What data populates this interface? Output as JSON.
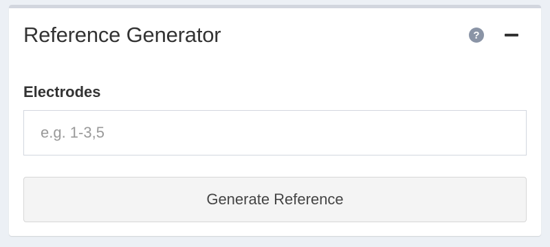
{
  "panel": {
    "title": "Reference Generator",
    "help_icon": "question-circle-icon",
    "collapse_icon": "minus-icon",
    "border_top_color": "#d2d6de"
  },
  "form": {
    "electrodes_label": "Electrodes",
    "electrodes_placeholder": "e.g. 1-3,5",
    "electrodes_value": "",
    "generate_label": "Generate Reference"
  }
}
